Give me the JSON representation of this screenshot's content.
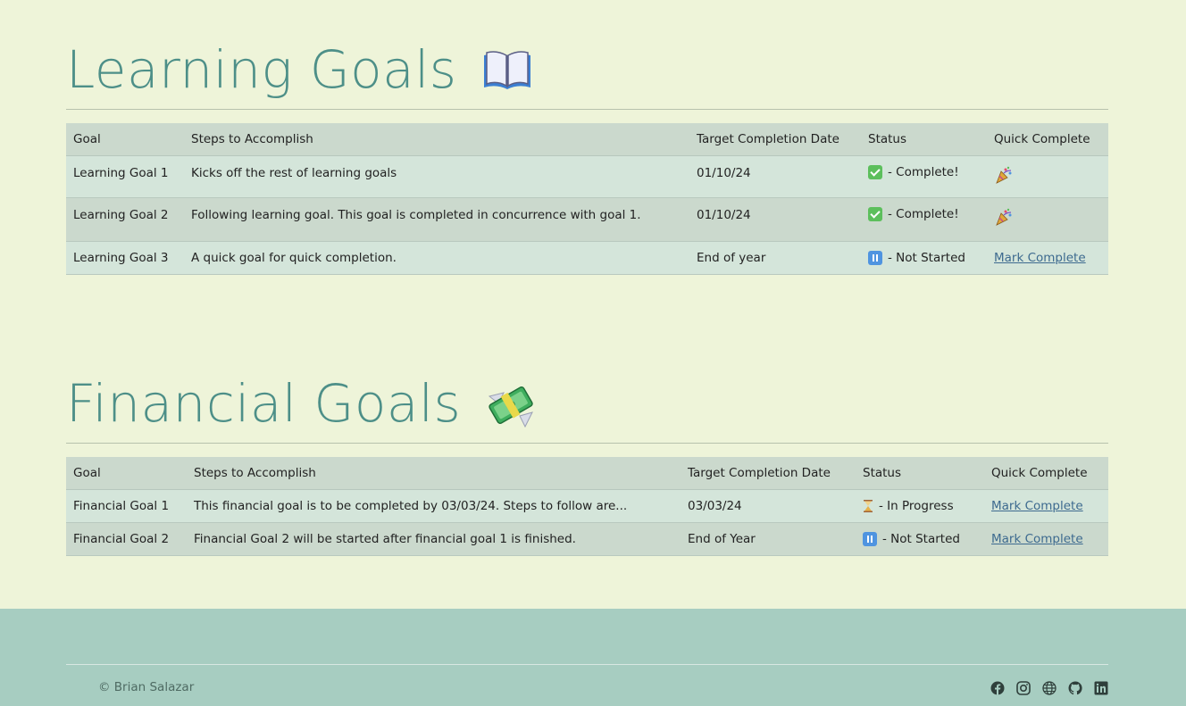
{
  "learning": {
    "title": "Learning Goals",
    "headers": [
      "Goal",
      "Steps to Accomplish",
      "Target Completion Date",
      "Status",
      "Quick Complete"
    ],
    "rows": [
      {
        "goal": "Learning Goal 1",
        "steps": "Kicks off the rest of learning goals",
        "date": "01/10/24",
        "status": "- Complete!",
        "status_icon": "check-icon",
        "quick": "party-popper-icon"
      },
      {
        "goal": "Learning Goal 2",
        "steps": "Following learning goal. This goal is completed in concurrence with goal 1.",
        "date": "01/10/24",
        "status": "- Complete!",
        "status_icon": "check-icon",
        "quick": "party-popper-icon"
      },
      {
        "goal": "Learning Goal 3",
        "steps": "A quick goal for quick completion.",
        "date": "End of year",
        "status": "- Not Started",
        "status_icon": "pause-icon",
        "quick": "Mark Complete"
      }
    ]
  },
  "financial": {
    "title": "Financial Goals",
    "headers": [
      "Goal",
      "Steps to Accomplish",
      "Target Completion Date",
      "Status",
      "Quick Complete"
    ],
    "rows": [
      {
        "goal": "Financial Goal 1",
        "steps": "This financial goal is to be completed by 03/03/24. Steps to follow are...",
        "date": "03/03/24",
        "status": "- In Progress",
        "status_icon": "hourglass-icon",
        "quick": "Mark Complete"
      },
      {
        "goal": "Financial Goal 2",
        "steps": "Financial Goal 2 will be started after financial goal 1 is finished.",
        "date": "End of Year",
        "status": "- Not Started",
        "status_icon": "pause-icon",
        "quick": "Mark Complete"
      }
    ]
  },
  "footer": {
    "copyright": "© Brian Salazar",
    "socials": [
      "facebook-icon",
      "instagram-icon",
      "globe-icon",
      "github-icon",
      "linkedin-icon"
    ]
  },
  "colors": {
    "background": "#eef4d9",
    "title": "#4d8f88",
    "footer": "#a7cdc1",
    "link": "#3d6a8f"
  }
}
